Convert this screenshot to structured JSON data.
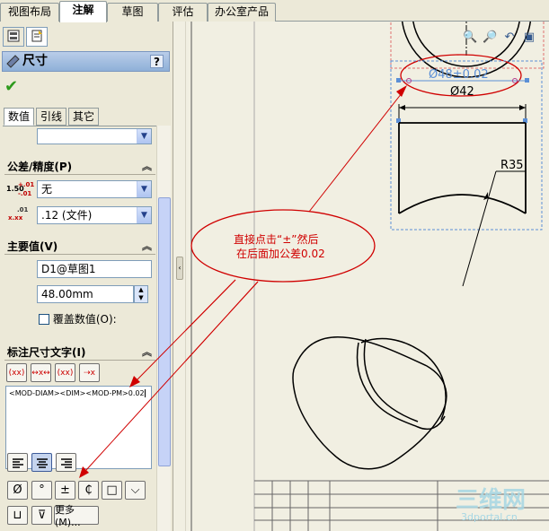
{
  "cmd_tabs": [
    "视图布局",
    "注解",
    "草图",
    "评估",
    "办公室产品"
  ],
  "pm": {
    "title": "尺寸",
    "help": "?",
    "ok": "✔",
    "sub_tabs": [
      "数值",
      "引线",
      "其它"
    ]
  },
  "tolerance": {
    "header": "公差/精度(P)",
    "tol_type": "无",
    "precision": ".12 (文件)",
    "tol_icon_top": "1.50",
    "tol_icon_sup": "+.01",
    "tol_icon_sub": "-.01",
    "prec_icon_top": ".01",
    "prec_icon_mid": "x.xx"
  },
  "primary": {
    "header": "主要值(V)",
    "ref": "D1@草图1",
    "value": "48.00mm",
    "override_label": "覆盖数值(O):"
  },
  "dimtext": {
    "header": "标注尺寸文字(I)",
    "content": "<MOD-DIAM><DIM><MOD-PM>0.02",
    "symbols": [
      "Ø",
      "°",
      "±",
      "₵",
      "□",
      "⌵"
    ],
    "symbols_row2": [
      "⊔",
      "⊽"
    ],
    "more_label": "更多(M)..."
  },
  "drawing": {
    "dim_top": "Ø48±0.02",
    "dim_42": "Ø42",
    "radius": "R35",
    "callout_line1": "直接点击“±”然后",
    "callout_line2": "在后面加公差0.02"
  },
  "watermark": {
    "logo": "三维网",
    "url": "3dportal.cn"
  },
  "colors": {
    "annotation_red": "#d00000",
    "dim_blue": "#5b8fd6",
    "panel_bg": "#ece9d8"
  }
}
